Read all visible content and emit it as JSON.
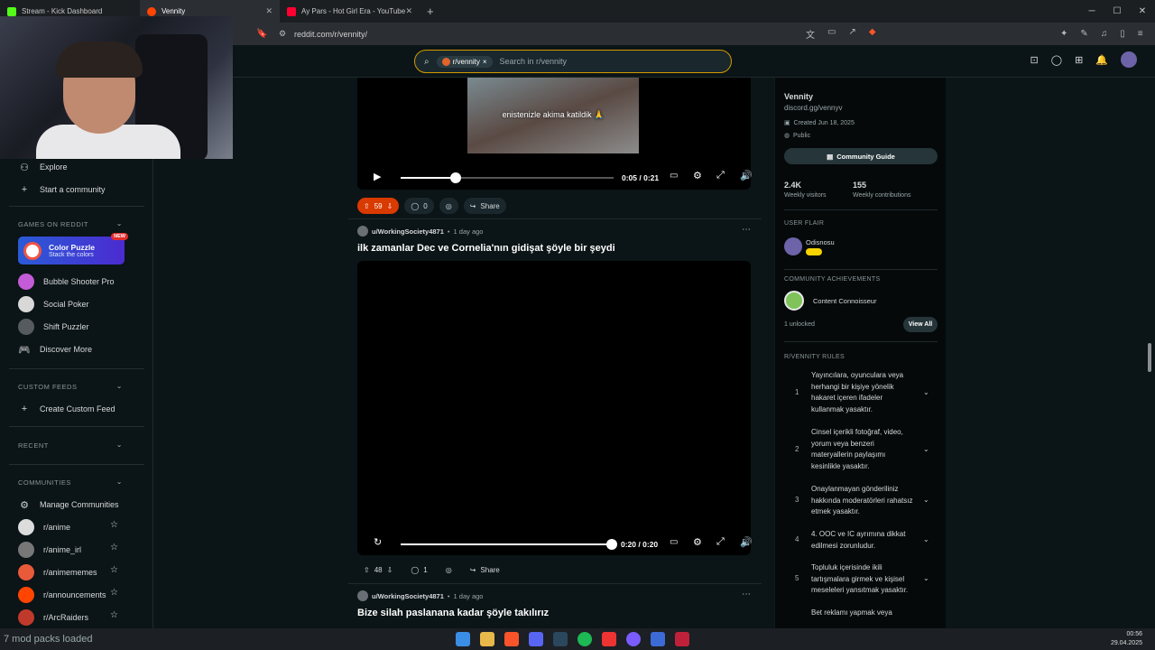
{
  "browser": {
    "tabs": [
      {
        "label": "Stream - Kick Dashboard",
        "active": false,
        "color": "#53fc18"
      },
      {
        "label": "Vennity",
        "active": true,
        "color": "#ff4500"
      },
      {
        "label": "Ay Pars - Hot Girl Era - YouTube",
        "active": false,
        "color": "#ff0033"
      }
    ],
    "new_tab": "+",
    "url": "reddit.com/r/vennity/"
  },
  "header": {
    "search_chip": "r/vennity",
    "search_chip_close": "×",
    "search_placeholder": "Search in r/vennity"
  },
  "sidebar": {
    "explore": "Explore",
    "start_community": "Start a community",
    "games_header": "GAMES ON REDDIT",
    "color_puzzle_title": "Color Puzzle",
    "color_puzzle_sub": "Stack the colors",
    "new_badge": "NEW",
    "games": [
      "Bubble Shooter Pro",
      "Social Poker",
      "Shift Puzzler",
      "Discover More"
    ],
    "custom_feeds_header": "CUSTOM FEEDS",
    "create_custom_feed": "Create Custom Feed",
    "recent_header": "RECENT",
    "communities_header": "COMMUNITIES",
    "manage_communities": "Manage Communities",
    "communities": [
      "r/anime",
      "r/anime_irl",
      "r/animememes",
      "r/announcements",
      "r/ArcRaiders"
    ]
  },
  "post1": {
    "caption": "enistenizle akima katildik 🙏",
    "time": "0:05 / 0:21",
    "progress": 0.26,
    "votes": "59",
    "comments": "0",
    "share": "Share"
  },
  "post2": {
    "user": "u/WorkingSociety4871",
    "age": "1 day ago",
    "title": "ilk zamanlar Dec ve Cornelia'nın gidişat şöyle bir şeydi",
    "time": "0:20 / 0:20",
    "progress": 1.0,
    "votes": "48",
    "comments": "1",
    "share": "Share"
  },
  "post3": {
    "user": "u/WorkingSociety4871",
    "age": "1 day ago",
    "title": "Bize silah paslanana kadar şöyle takılırız"
  },
  "right_sidebar": {
    "name": "Vennity",
    "link": "discord.gg/vennyv",
    "created": "Created Jun 18, 2025",
    "visibility": "Public",
    "guide_button": "Community Guide",
    "weekly_visitors_value": "2.4K",
    "weekly_visitors_label": "Weekly visitors",
    "weekly_contrib_value": "155",
    "weekly_contrib_label": "Weekly contributions",
    "user_flair_header": "USER FLAIR",
    "flair_user": "Odisnosu",
    "achievements_header": "COMMUNITY ACHIEVEMENTS",
    "achievement": "Content Connoisseur",
    "unlocked": "1 unlocked",
    "view_all": "View All",
    "rules_header": "R/VENNITY RULES",
    "rules": [
      {
        "num": "1",
        "text": "Yayıncılara, oyunculara veya herhangi bir kişiye yönelik hakaret içeren ifadeler kullanmak yasaktır."
      },
      {
        "num": "2",
        "text": "Cinsel içerikli fotoğraf, video, yorum veya benzeri materyallerin paylaşımı kesinlikle yasaktır."
      },
      {
        "num": "3",
        "text": "Onaylanmayan gönderiliniz hakkında moderatörleri rahatsız etmek yasaktır."
      },
      {
        "num": "4",
        "text": "4. OOC ve IC ayrımına dikkat edilmesi zorunludur."
      },
      {
        "num": "5",
        "text": "Topluluk içerisinde ikili tartışmalara girmek ve kişisel meseleleri yansıtmak yasaktır."
      },
      {
        "num": "",
        "text": "Bet reklamı yapmak veya"
      }
    ]
  },
  "taskbar": {
    "overlay_text": "7 mod packs loaded",
    "time": "00:56",
    "date": "29.04.2025"
  }
}
